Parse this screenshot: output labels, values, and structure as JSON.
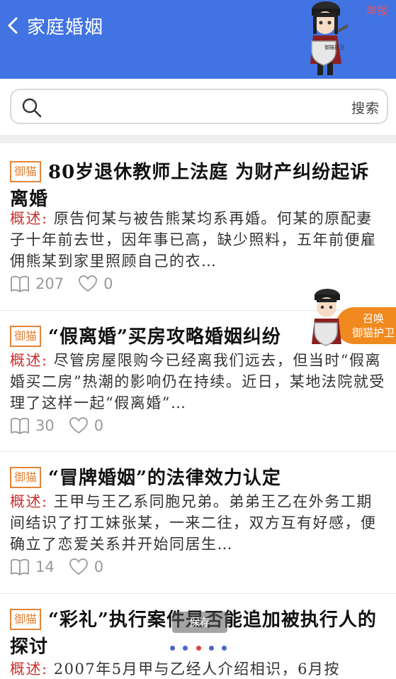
{
  "header": {
    "title": "家庭婚姻",
    "report": "举报",
    "mascot_shield_text": "御猫护卫"
  },
  "search": {
    "placeholder": "",
    "button": "搜索"
  },
  "articles": [
    {
      "tag": "御猫",
      "title": "80岁退休教师上法庭 为财产纠纷起诉离婚",
      "desc_label": "概述:",
      "desc": "原告何某与被告熊某均系再婚。何某的原配妻子十年前去世，因年事已高，缺少照料，五年前便雇佣熊某到家里照顾自己的衣…",
      "reads": "207",
      "likes": "0"
    },
    {
      "tag": "御猫",
      "title": "“假离婚”买房攻略婚姻纠纷",
      "desc_label": "概述:",
      "desc": "尽管房屋限购今已经离我们远去，但当时“假离婚买二房”热潮的影响仍在持续。近日，某地法院就受理了这样一起“假离婚”…",
      "reads": "30",
      "likes": "0"
    },
    {
      "tag": "御猫",
      "title": "“冒牌婚姻”的法律效力认定",
      "desc_label": "概述:",
      "desc": "王甲与王乙系同胞兄弟。弟弟王乙在外务工期间结识了打工妹张某，一来二往，双方互有好感，便确立了恋爱关系并开始同居生…",
      "reads": "14",
      "likes": "0"
    },
    {
      "tag": "御猫",
      "title": "“彩礼”执行案件是否能追加被执行人的探讨",
      "desc_label": "概述:",
      "desc": "2007年5月甲与乙经人介绍相识，6月按",
      "reads": "",
      "likes": ""
    }
  ],
  "floating": {
    "summon_line1": "召唤",
    "summon_line2": "御猫护卫",
    "mascot_shield_text": "御猫护卫"
  },
  "toast": "保存",
  "carousel": {
    "count": 5,
    "active_index": 2
  },
  "colors": {
    "header_bg": "#4173e2",
    "tag": "#e2843a",
    "desc_label": "#c9312e",
    "summon_badge": "#f08a1f",
    "report": "#ff4d4d"
  }
}
